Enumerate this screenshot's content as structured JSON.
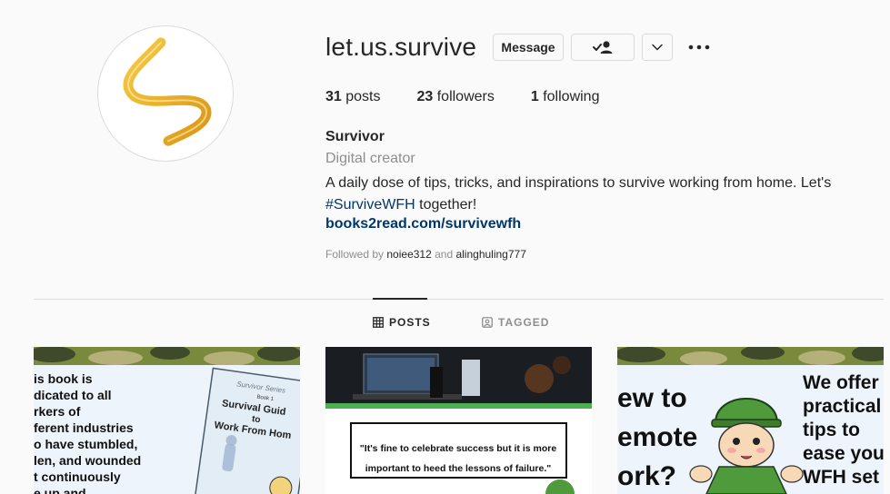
{
  "profile": {
    "username": "let.us.survive",
    "avatar_icon": "golden-s-logo",
    "full_name": "Survivor",
    "category": "Digital creator",
    "bio_text": "A daily dose of tips, tricks, and inspirations to survive working from home. Let's",
    "bio_hashtag": "#SurviveWFH",
    "bio_tail": " together!",
    "link": "books2read.com/survivewfh",
    "followed_by_prefix": "Followed by ",
    "followed_by_1": "noiee312",
    "followed_by_and": " and ",
    "followed_by_2": "alinghuling777"
  },
  "actions": {
    "message_label": "Message",
    "following_icon": "person-check-icon",
    "dropdown_icon": "chevron-down-icon",
    "more_icon": "more-options-icon"
  },
  "stats": {
    "posts_count": "31",
    "posts_label": " posts",
    "followers_count": "23",
    "followers_label": " followers",
    "following_count": "1",
    "following_label": " following"
  },
  "tabs": {
    "posts": "POSTS",
    "tagged": "TAGGED"
  },
  "posts": [
    {
      "lines": [
        "is book is",
        "dicated to all",
        "rkers of",
        "ferent industries",
        "o have stumbled,",
        "len, and wounded",
        "t continuously",
        "e up and"
      ],
      "book_series": "Survivor Series",
      "book_no": "Book 1",
      "book_title_1": "Survival Guid",
      "book_title_2": "to",
      "book_title_3": "Work From Hom"
    },
    {
      "quote_1": "\"It's fine to celebrate success but it is more",
      "quote_2": "important to heed the lessons of failure.\""
    },
    {
      "left_1": "ew to",
      "left_2": "emote",
      "left_3": "ork?",
      "right_1": "We offer",
      "right_2": "practical",
      "right_3": "tips to",
      "right_4": "ease you",
      "right_5": "WFH set"
    }
  ],
  "colors": {
    "link_blue": "#00376b",
    "muted_gray": "#8e8e8e",
    "border": "#dbdbdb",
    "camo_dark": "#3f4a2a",
    "camo_green": "#7a8a3d",
    "camo_tan": "#b5b07a",
    "soldier_green": "#4f9a3a",
    "logo_gold": "#f0b429"
  }
}
